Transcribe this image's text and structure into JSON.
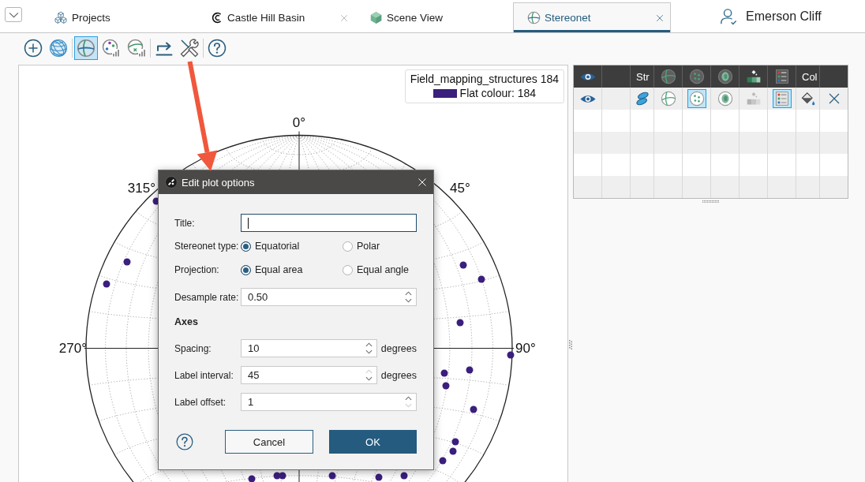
{
  "tabs": [
    {
      "label": "Projects",
      "kind": "projects",
      "closable": false,
      "selected": false
    },
    {
      "label": "Castle Hill Basin",
      "kind": "project",
      "closable": true,
      "selected": false
    },
    {
      "label": "Scene View",
      "kind": "scene",
      "closable": false,
      "selected": false
    },
    {
      "label": "Stereonet",
      "kind": "stereonet",
      "closable": true,
      "selected": true
    }
  ],
  "user": {
    "name": "Emerson Cliff"
  },
  "toolbar": {
    "groups": [
      [
        {
          "kind": "add",
          "selected": false
        },
        {
          "kind": "mesh-globe",
          "selected": false
        }
      ],
      [
        {
          "kind": "stereonet",
          "selected": true
        },
        {
          "kind": "palette-chart",
          "selected": false
        },
        {
          "kind": "circle-x-chart",
          "selected": false
        }
      ],
      [
        {
          "kind": "export",
          "selected": false
        },
        {
          "kind": "tools",
          "selected": false
        }
      ],
      [
        {
          "kind": "help",
          "selected": false
        }
      ]
    ]
  },
  "plot": {
    "legend": {
      "title": "Field_mapping_structures 184",
      "entries": [
        {
          "label": "Flat colour: 184",
          "color": "#3a1f7d"
        }
      ]
    },
    "angle_labels": [
      "0°",
      "315°",
      "45°",
      "270°",
      "90°"
    ]
  },
  "layers": {
    "columns": [
      {
        "kind": "eye"
      },
      {
        "kind": "blank"
      },
      {
        "kind": "text",
        "label": "Str"
      },
      {
        "kind": "globe"
      },
      {
        "kind": "globe-dots"
      },
      {
        "kind": "ring"
      },
      {
        "kind": "paint-bar"
      },
      {
        "kind": "list"
      },
      {
        "kind": "text",
        "label": "Col"
      },
      {
        "kind": "blank"
      }
    ],
    "rows": [
      {
        "cells": [
          {
            "kind": "eye"
          },
          {
            "kind": "blank"
          },
          {
            "kind": "discs"
          },
          {
            "kind": "globe",
            "selected": false
          },
          {
            "kind": "globe-dots",
            "selected": true
          },
          {
            "kind": "ring",
            "selected": false
          },
          {
            "kind": "paint-bar",
            "selected": false,
            "disabled": true
          },
          {
            "kind": "list",
            "selected": true
          },
          {
            "kind": "bucket"
          },
          {
            "kind": "close"
          }
        ]
      }
    ]
  },
  "dialog": {
    "title": "Edit plot options",
    "fields": [
      {
        "kind": "text",
        "label": "Title:",
        "focused": true
      },
      {
        "kind": "radio",
        "label": "Stereonet type:",
        "options": [
          {
            "label": "Equatorial",
            "selected": true
          },
          {
            "label": "Polar",
            "selected": false
          }
        ]
      },
      {
        "kind": "radio",
        "label": "Projection:",
        "options": [
          {
            "label": "Equal area",
            "selected": true
          },
          {
            "label": "Equal angle",
            "selected": false
          }
        ]
      },
      {
        "kind": "spin",
        "label": "Desample rate:",
        "value": "0.50",
        "step_up_disabled": false,
        "step_down_disabled": false
      },
      {
        "kind": "heading",
        "label": "Axes"
      },
      {
        "kind": "spin",
        "label": "Spacing:",
        "value": "10",
        "unit": "degrees",
        "step_up_disabled": false,
        "step_down_disabled": false
      },
      {
        "kind": "spin",
        "label": "Label interval:",
        "value": "45",
        "unit": "degrees",
        "step_up_disabled": true,
        "step_down_disabled": false
      },
      {
        "kind": "spin",
        "label": "Label offset:",
        "value": "1",
        "step_up_disabled": false,
        "step_down_disabled": true
      }
    ],
    "buttons": [
      {
        "label": "Cancel",
        "kind": "secondary"
      },
      {
        "label": "OK",
        "kind": "primary"
      }
    ]
  }
}
